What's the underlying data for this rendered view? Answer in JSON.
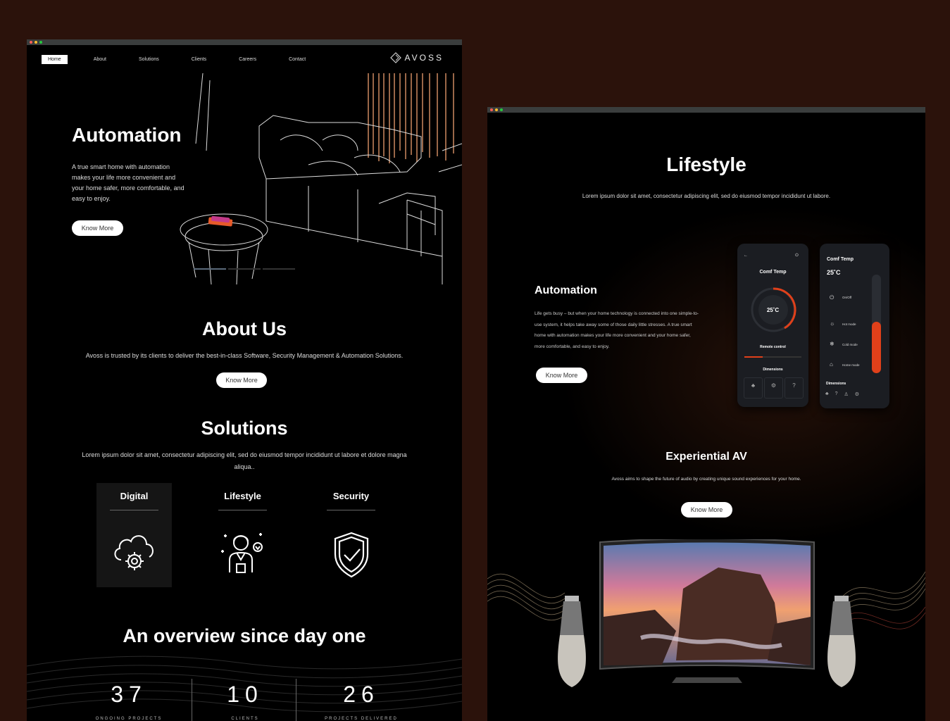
{
  "colors": {
    "bg": "#2b120b",
    "accent": "#e0401a",
    "window": "#000000"
  },
  "left": {
    "nav": [
      "Home",
      "About",
      "Solutions",
      "Clients",
      "Careers",
      "Contact"
    ],
    "logo": "AVOSS",
    "hero": {
      "title": "Automation",
      "desc": "A true smart home with automation makes your life more convenient and your home safer, more comfortable, and easy to enjoy.",
      "button": "Know More"
    },
    "about": {
      "title": "About Us",
      "text": "Avoss is trusted by its clients to deliver the best-in-class Software, Security Management & Automation Solutions.",
      "button": "Know More"
    },
    "solutions": {
      "title": "Solutions",
      "text": "Lorem ipsum dolor sit amet, consectetur adipiscing elit, sed do eiusmod tempor incididunt ut labore et dolore magna aliqua..",
      "items": [
        {
          "label": "Digital",
          "icon": "cloud-gear-icon"
        },
        {
          "label": "Lifestyle",
          "icon": "person-heart-icon"
        },
        {
          "label": "Security",
          "icon": "shield-check-icon"
        }
      ]
    },
    "overview": {
      "title": "An overview since day one",
      "stats": [
        {
          "num": "37",
          "label": "ONGOING PROJECTS"
        },
        {
          "num": "10",
          "label": "CLIENTS"
        },
        {
          "num": "26",
          "label": "PROJECTS DELIVERED"
        }
      ]
    }
  },
  "right": {
    "title": "Lifestyle",
    "subtitle": "Lorem ipsum dolor sit amet, consectetur adipiscing elit, sed do eiusmod tempor incididunt ut labore.",
    "automation": {
      "title": "Automation",
      "text": "Life gets busy – but when your home technology is connected into one simple-to-use system, it helps take away some of those daily little stresses. A true smart home with automation makes your life more convenient and your home safer, more comfortable, and easy to enjoy.",
      "button": "Know More"
    },
    "phone1": {
      "title": "Comf Temp",
      "temp": "25˚C",
      "remote": "Remote control",
      "dims": "Dimensions"
    },
    "phone2": {
      "title": "Comf Temp",
      "temp": "25˚C",
      "modes": [
        "On/Off",
        "Hot mode",
        "Cold mode",
        "Home mode"
      ],
      "dims": "Dimensions",
      "level": 0.52
    },
    "av": {
      "title": "Experiential AV",
      "text": "Avoss aims to shape the future of audio by creating unique sound experiences for your home.",
      "button": "Know More"
    }
  }
}
